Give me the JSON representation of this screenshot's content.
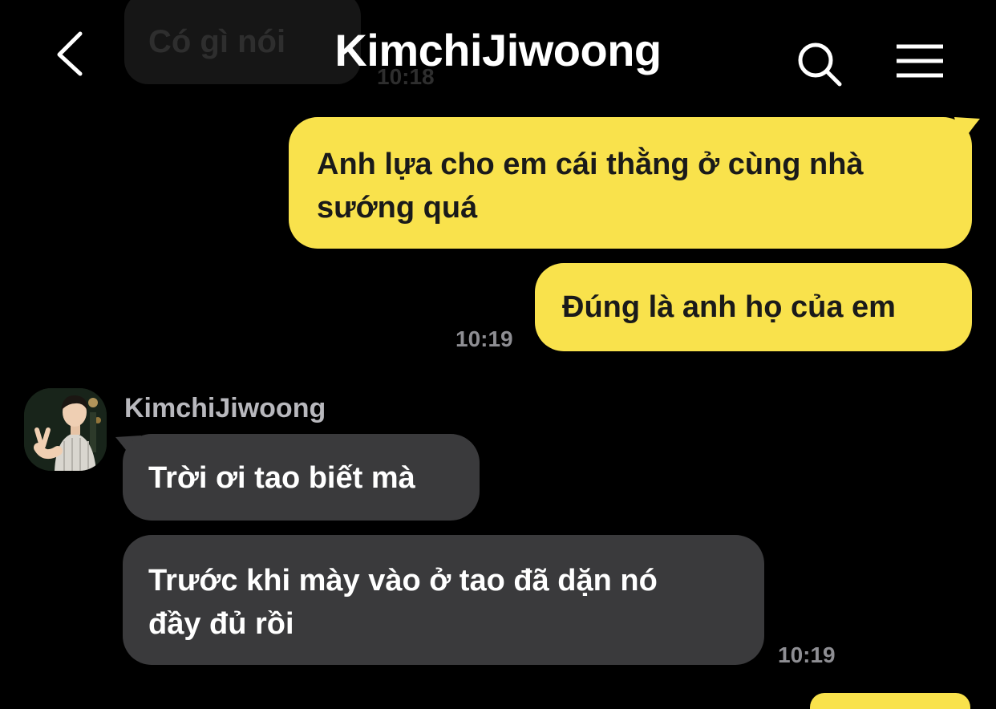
{
  "header": {
    "title": "KimchiJiwoong",
    "back_icon": "chevron-left-icon",
    "search_icon": "search-icon",
    "menu_icon": "hamburger-menu-icon"
  },
  "previous_message": {
    "text": "Có gì nói",
    "time": "10:18"
  },
  "messages": [
    {
      "direction": "outgoing",
      "lines": [
        "Anh lựa cho em cái thằng ở cùng nhà",
        "sướng quá"
      ]
    },
    {
      "direction": "outgoing",
      "lines": [
        "Đúng là anh họ của em"
      ],
      "time": "10:19"
    },
    {
      "direction": "incoming",
      "sender": "KimchiJiwoong",
      "lines": [
        "Trời ơi tao biết mà"
      ]
    },
    {
      "direction": "incoming",
      "lines": [
        "Trước khi mày vào ở tao đã dặn nó",
        "đầy đủ rồi"
      ],
      "time": "10:19"
    }
  ],
  "colors": {
    "background": "#000000",
    "outgoing_bubble": "#f9e24c",
    "incoming_bubble": "#3a3a3c",
    "timestamp": "#8e8e93"
  }
}
